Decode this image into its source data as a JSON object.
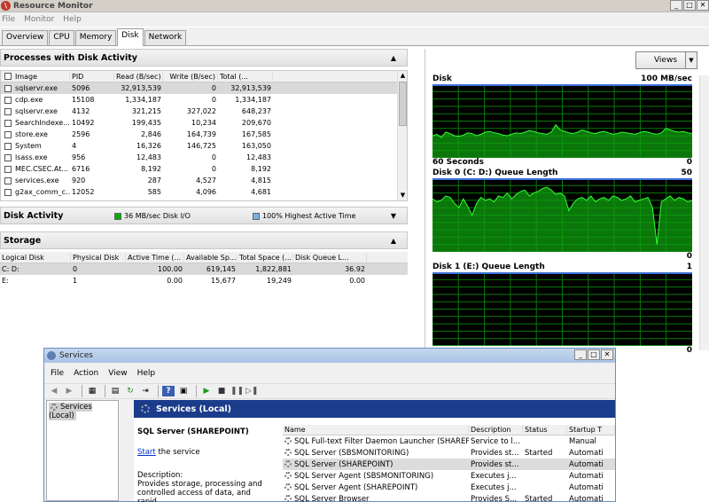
{
  "window": {
    "title": "Resource Monitor"
  },
  "menu": [
    "File",
    "Monitor",
    "Help"
  ],
  "tabs": [
    "Overview",
    "CPU",
    "Memory",
    "Disk",
    "Network"
  ],
  "processes": {
    "title": "Processes with Disk Activity",
    "columns": [
      "Image",
      "PID",
      "Read (B/sec)",
      "Write (B/sec)",
      "Total (..."
    ],
    "rows": [
      [
        "sqlservr.exe",
        "5096",
        "32,913,539",
        "0",
        "32,913,539"
      ],
      [
        "cdp.exe",
        "15108",
        "1,334,187",
        "0",
        "1,334,187"
      ],
      [
        "sqlservr.exe",
        "4132",
        "321,215",
        "327,022",
        "648,237"
      ],
      [
        "SearchIndexe...",
        "10492",
        "199,435",
        "10,234",
        "209,670"
      ],
      [
        "store.exe",
        "2596",
        "2,846",
        "164,739",
        "167,585"
      ],
      [
        "System",
        "4",
        "16,326",
        "146,725",
        "163,050"
      ],
      [
        "lsass.exe",
        "956",
        "12,483",
        "0",
        "12,483"
      ],
      [
        "MEC.CSEC.At...",
        "6716",
        "8,192",
        "0",
        "8,192"
      ],
      [
        "services.exe",
        "920",
        "287",
        "4,527",
        "4,815"
      ],
      [
        "g2ax_comm_c...",
        "12052",
        "585",
        "4,096",
        "4,681"
      ]
    ]
  },
  "disk_activity": {
    "title": "Disk Activity",
    "io_label": "36 MB/sec Disk I/O",
    "active_label": "100% Highest Active Time",
    "io_color": "#00b000",
    "active_color": "#7ab0e6"
  },
  "storage": {
    "title": "Storage",
    "columns": [
      "Logical Disk",
      "Physical Disk",
      "Active Time (...",
      "Available Sp...",
      "Total Space (...",
      "Disk Queue L..."
    ],
    "rows": [
      [
        "C: D:",
        "0",
        "100.00",
        "619,145",
        "1,822,881",
        "36.92"
      ],
      [
        "E:",
        "1",
        "0.00",
        "15,677",
        "19,249",
        "0.00"
      ]
    ]
  },
  "charts_pane": {
    "views_label": "Views",
    "disk": {
      "title": "Disk",
      "max": "100 MB/sec",
      "footer_left": "60 Seconds",
      "footer_right": "0"
    },
    "queue0": {
      "title": "Disk 0 (C: D:) Queue Length",
      "max": "50",
      "footer_right": "0"
    },
    "queue1": {
      "title": "Disk 1 (E:) Queue Length",
      "max": "1",
      "footer_right": "0"
    }
  },
  "chart_data": [
    {
      "type": "area",
      "title": "Disk",
      "ymax_label": "100 MB/sec",
      "xlabel": "60 Seconds",
      "values": [
        30,
        32,
        28,
        35,
        33,
        30,
        29,
        31,
        34,
        33,
        30,
        32,
        35,
        36,
        34,
        33,
        31,
        30,
        32,
        34,
        33,
        35,
        37,
        36,
        34,
        33,
        32,
        35,
        45,
        38,
        36,
        34,
        33,
        35,
        38,
        36,
        34,
        33,
        35,
        36,
        34,
        32,
        33,
        35,
        34,
        33,
        32,
        34,
        36,
        35,
        33,
        32,
        34,
        40,
        38,
        36,
        35,
        36,
        34,
        33
      ]
    },
    {
      "type": "area",
      "title": "Disk 0 (C: D:) Queue Length",
      "ymax_label": "50",
      "values": [
        36,
        34,
        35,
        38,
        37,
        33,
        30,
        36,
        31,
        25,
        33,
        37,
        35,
        36,
        34,
        38,
        37,
        40,
        36,
        39,
        41,
        42,
        38,
        40,
        41,
        43,
        44,
        42,
        39,
        40,
        38,
        28,
        33,
        36,
        37,
        35,
        38,
        34,
        36,
        37,
        35,
        38,
        37,
        35,
        36,
        38,
        34,
        35,
        36,
        37,
        30,
        5,
        34,
        36,
        38,
        35,
        37,
        36,
        34,
        35
      ]
    },
    {
      "type": "area",
      "title": "Disk 1 (E:) Queue Length",
      "ymax_label": "1",
      "values": [
        0,
        0,
        0,
        0,
        0,
        0,
        0,
        0,
        0,
        0,
        0,
        0,
        0,
        0,
        0,
        0,
        0,
        0,
        0,
        0
      ]
    }
  ],
  "services": {
    "title": "Services",
    "menu": [
      "File",
      "Action",
      "View",
      "Help"
    ],
    "tree_item": "Services (Local)",
    "header": "Services (Local)",
    "selected_name": "SQL Server (SHAREPOINT)",
    "start_link": "Start",
    "start_suffix": " the service",
    "description_label": "Description:",
    "description_text": "Provides storage, processing and controlled access of data, and rapid",
    "columns": [
      "Name",
      "Description",
      "Status",
      "Startup T"
    ],
    "rows": [
      [
        "SQL Full-text Filter Daemon Launcher (SHAREP...",
        "Service to l...",
        "",
        "Manual"
      ],
      [
        "SQL Server (SBSMONITORING)",
        "Provides st...",
        "Started",
        "Automati"
      ],
      [
        "SQL Server (SHAREPOINT)",
        "Provides st...",
        "",
        "Automati"
      ],
      [
        "SQL Server Agent (SBSMONITORING)",
        "Executes j...",
        "",
        "Automati"
      ],
      [
        "SQL Server Agent (SHAREPOINT)",
        "Executes j...",
        "",
        "Automati"
      ],
      [
        "SQL Server Browser",
        "Provides S...",
        "Started",
        "Automati"
      ]
    ]
  }
}
